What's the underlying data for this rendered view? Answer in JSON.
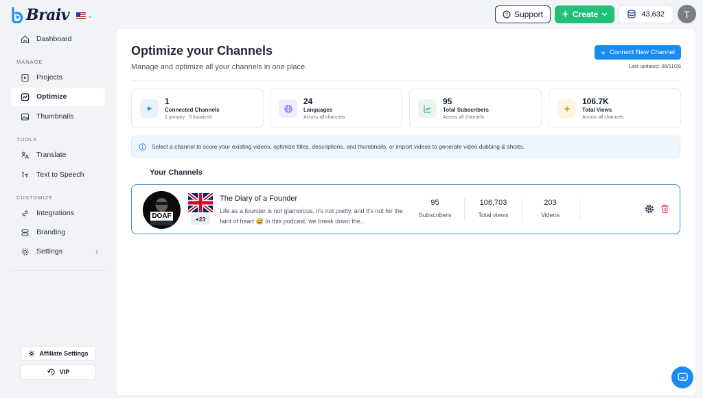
{
  "app": {
    "brand": "Braiv"
  },
  "header": {
    "support_label": "Support",
    "create_label": "Create",
    "credits": "43,632",
    "user_initial": "T"
  },
  "sidebar": {
    "dashboard": "Dashboard",
    "sections": {
      "manage": "MANAGE",
      "tools": "TOOLS",
      "customize": "CUSTOMIZE"
    },
    "items": {
      "projects": "Projects",
      "optimize": "Optimize",
      "thumbnails": "Thumbnails",
      "translate": "Translate",
      "tts": "Text to Speech",
      "integrations": "Integrations",
      "branding": "Branding",
      "settings": "Settings"
    },
    "affiliate_label": "Affiliate Settings",
    "vip_label": "VIP"
  },
  "page": {
    "title": "Optimize your Channels",
    "subtitle": "Manage and optimize all your channels in one place.",
    "connect_label": "Connect New Channel",
    "last_updated": "Last updated: 08/11/26"
  },
  "stats": [
    {
      "value": "1",
      "label": "Connected Channels",
      "sub": "1 primary · 0 localized",
      "icon": "play-icon",
      "color": "#2f86e0"
    },
    {
      "value": "24",
      "label": "Languages",
      "sub": "Across all channels",
      "icon": "globe-icon",
      "color": "#8b5cf6"
    },
    {
      "value": "95",
      "label": "Total Subscribers",
      "sub": "Across all channels",
      "icon": "trend-icon",
      "color": "#22a06b"
    },
    {
      "value": "106.7K",
      "label": "Total Views",
      "sub": "Across all channels",
      "icon": "sparkle-icon",
      "color": "#e0a020"
    }
  ],
  "info_text": "Select a channel to score your existing videos, optimize titles, descriptions, and thumbnails, or import videos to generate video dubbing & shorts.",
  "channels_title": "Your Channels",
  "channel": {
    "name": "The Diary of a Founder",
    "logo_text": "DOAF",
    "extra_languages": "+23",
    "description": "Life as a founder is not glamorous, it's not pretty, and it's not for the faint of heart 😅 In this podcast, we break down the...",
    "subscribers": "95",
    "subscribers_label": "Subscribers",
    "views": "106,703",
    "views_label": "Total views",
    "videos": "203",
    "videos_label": "Videos"
  },
  "colors": {
    "accent": "#1a8cf0",
    "create": "#20c27a",
    "card_border": "#3a8fd6"
  }
}
